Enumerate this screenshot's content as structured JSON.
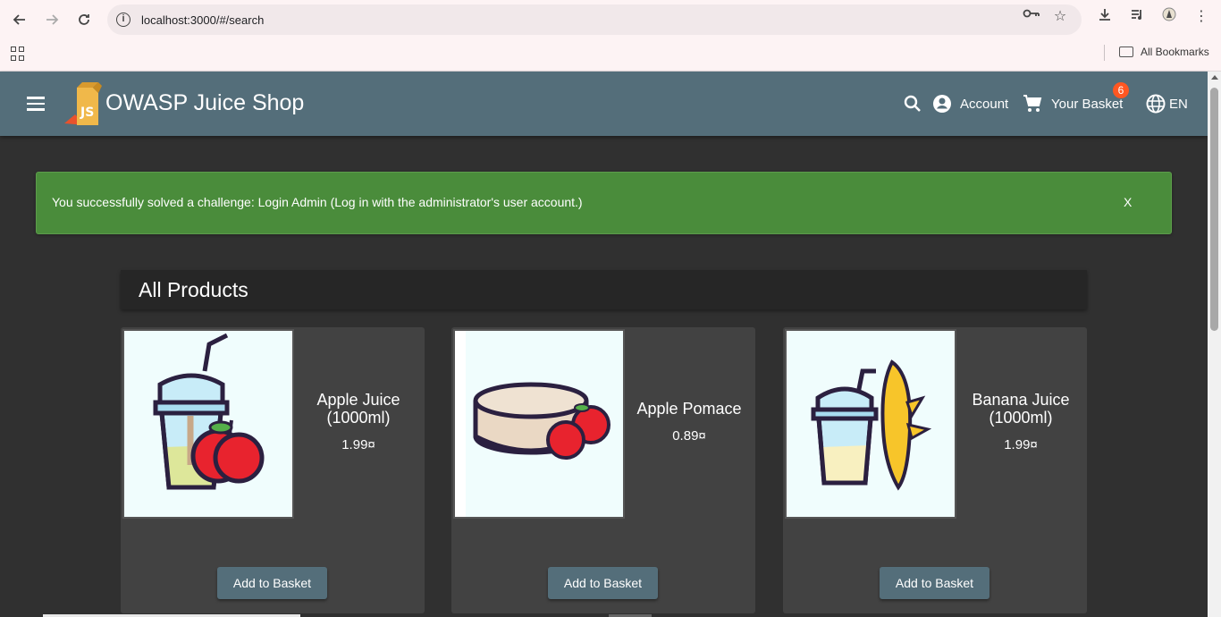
{
  "browser": {
    "url": "localhost:3000/#/search",
    "bookmarks_label": "All Bookmarks"
  },
  "app": {
    "title": "OWASP Juice Shop",
    "account_label": "Account",
    "basket_label": "Your Basket",
    "basket_count": "6",
    "language_label": "EN"
  },
  "snackbar": {
    "message": "You successfully solved a challenge: Login Admin (Log in with the administrator's user account.)",
    "close_label": "X"
  },
  "products": {
    "heading": "All Products",
    "items": [
      {
        "name": "Apple Juice (1000ml)",
        "price": "1.99¤",
        "button": "Add to Basket",
        "image_icon": "apple-juice-image"
      },
      {
        "name": "Apple Pomace",
        "price": "0.89¤",
        "button": "Add to Basket",
        "image_icon": "apple-pomace-image"
      },
      {
        "name": "Banana Juice (1000ml)",
        "price": "1.99¤",
        "button": "Add to Basket",
        "image_icon": "banana-juice-image"
      }
    ]
  },
  "colors": {
    "toolbar": "#546e7a",
    "background": "#303030",
    "snackbar": "#4a8c3b",
    "card": "#424242",
    "badge": "#ff5722"
  }
}
